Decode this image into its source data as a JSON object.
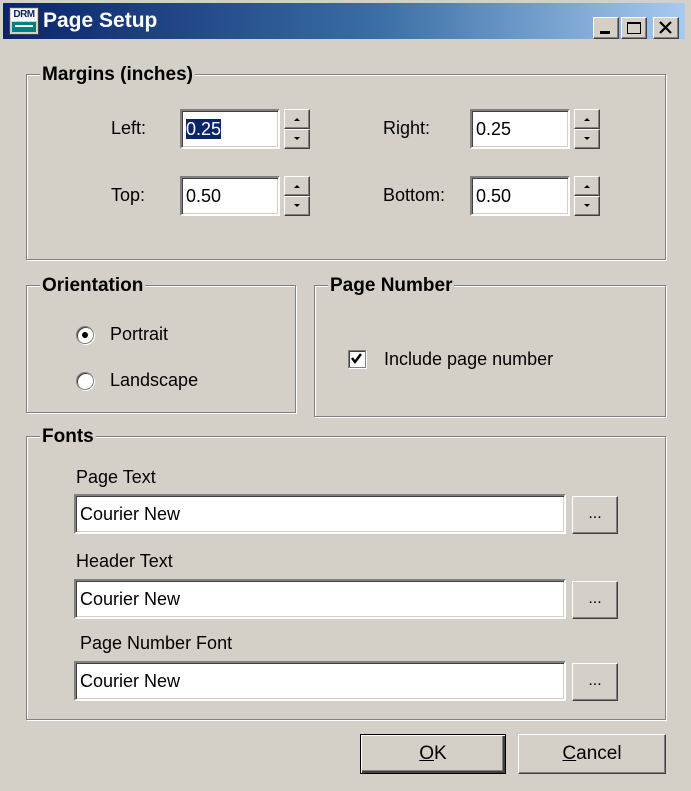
{
  "window": {
    "title": "Page Setup",
    "icon_text": "DRM",
    "controls": [
      "minimize",
      "maximize",
      "close"
    ]
  },
  "margins": {
    "legend": "Margins (inches)",
    "left_label": "Left:",
    "left_value": "0.25",
    "right_label": "Right:",
    "right_value": "0.25",
    "top_label": "Top:",
    "top_value": "0.50",
    "bottom_label": "Bottom:",
    "bottom_value": "0.50"
  },
  "orientation": {
    "legend": "Orientation",
    "options": [
      "Portrait",
      "Landscape"
    ],
    "selected": "Portrait"
  },
  "page_number": {
    "legend": "Page Number",
    "include_label": "Include page number",
    "include_checked": true
  },
  "fonts": {
    "legend": "Fonts",
    "page_text_label": "Page Text",
    "page_text_value": "Courier New",
    "header_text_label": "Header Text",
    "header_text_value": "Courier New",
    "page_number_font_label": "Page Number Font",
    "page_number_font_value": "Courier New",
    "browse_label": "..."
  },
  "buttons": {
    "ok_mnemonic": "O",
    "ok_rest": "K",
    "cancel_mnemonic": "C",
    "cancel_rest": "ancel"
  },
  "colors": {
    "face": "#d4d0c8",
    "title_start": "#0a246a",
    "title_end": "#a6caf0",
    "selection": "#0a246a"
  }
}
